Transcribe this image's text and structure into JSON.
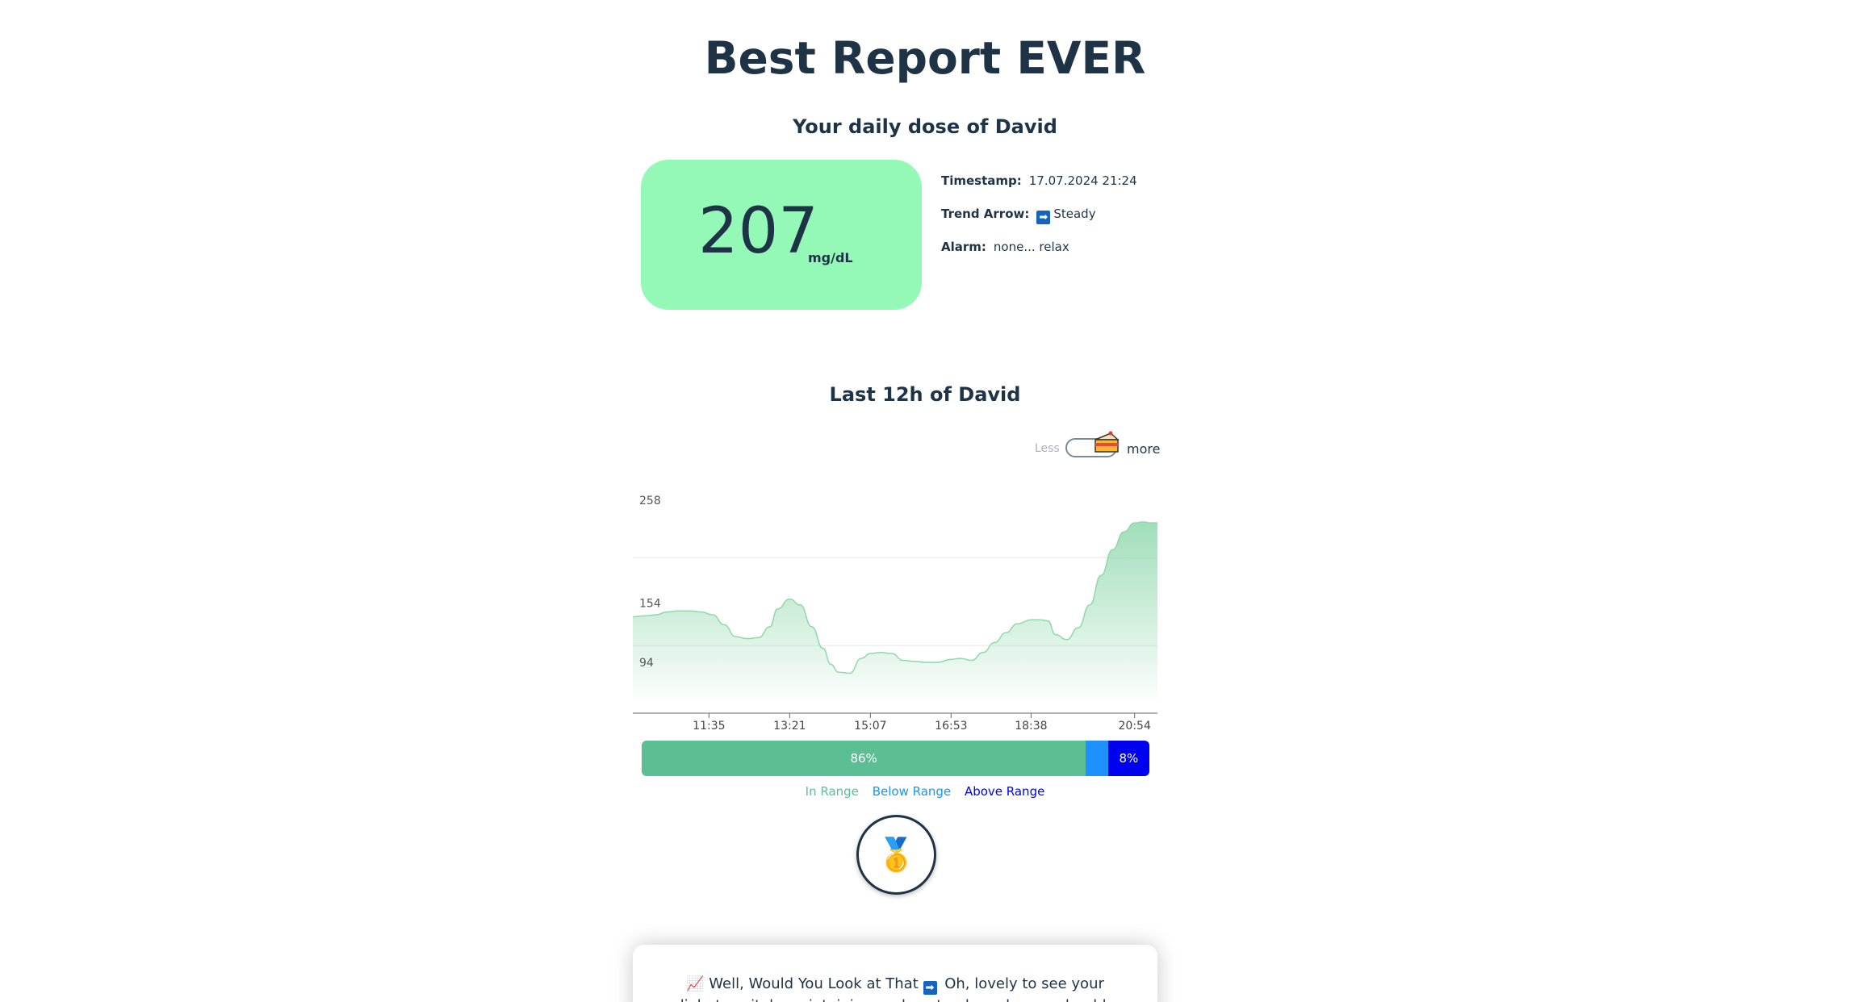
{
  "header": {
    "title": "Best Report EVER",
    "subtitle": "Your daily dose of David"
  },
  "reading": {
    "value": "207",
    "unit": "mg/dL",
    "card_color": "#94f9b7"
  },
  "info": {
    "timestamp_label": "Timestamp:",
    "timestamp_value": "17.07.2024 21:24",
    "trend_label": "Trend Arrow:",
    "trend_icon": "➡",
    "trend_value": "Steady",
    "alarm_label": "Alarm:",
    "alarm_value": "none... relax"
  },
  "chart_section": {
    "title": "Last 12h of David",
    "toggle_less": "Less",
    "toggle_more": "more",
    "toggle_icon": "cake-icon",
    "toggle_state": "on"
  },
  "chart_data": {
    "type": "area",
    "x_tick_labels": [
      "11:35",
      "13:21",
      "15:07",
      "16:53",
      "18:38",
      "20:54"
    ],
    "y_tick_labels": [
      "258",
      "154",
      "94"
    ],
    "ylim": [
      54,
      258
    ],
    "grid": "horizontal",
    "line_color": "#8fd8ac",
    "series": [
      {
        "x": [
          "09:55",
          "10:10",
          "10:25",
          "10:40",
          "10:55",
          "11:10",
          "11:25",
          "11:40",
          "11:55",
          "12:10",
          "12:25",
          "12:40",
          "12:55",
          "13:05",
          "13:21",
          "13:35",
          "13:50",
          "14:05",
          "14:15",
          "14:25",
          "14:40",
          "14:55",
          "15:07",
          "15:20",
          "15:35",
          "15:50",
          "16:05",
          "16:20",
          "16:35",
          "16:53",
          "17:05",
          "17:20",
          "17:35",
          "17:50",
          "18:05",
          "18:20",
          "18:38",
          "18:50",
          "19:00",
          "19:10",
          "19:25",
          "19:40",
          "19:55",
          "20:10",
          "20:25",
          "20:40",
          "20:54",
          "21:05",
          "21:15",
          "21:24"
        ],
        "values": [
          140,
          141,
          142,
          145,
          146,
          146,
          145,
          142,
          132,
          120,
          118,
          119,
          130,
          148,
          158,
          152,
          130,
          108,
          92,
          84,
          83,
          98,
          103,
          104,
          103,
          96,
          95,
          94,
          94,
          97,
          98,
          96,
          104,
          114,
          124,
          133,
          137,
          137,
          136,
          122,
          117,
          129,
          152,
          182,
          208,
          226,
          235,
          236,
          235,
          235
        ]
      }
    ]
  },
  "range_bar": {
    "in_range_pct": 86,
    "below_range_pct": 4.3,
    "above_range_pct": 8,
    "in_range_label": "86%",
    "above_range_label": "8%",
    "colors": {
      "in": "#5cbf94",
      "below": "#1e90ff",
      "above": "#0000f0"
    }
  },
  "legend": {
    "in_range": "In Range",
    "below_range": "Below Range",
    "above_range": "Above Range"
  },
  "medal": {
    "icon": "🥇",
    "icon_name": "medal-icon"
  },
  "message": {
    "icon1": "📈",
    "text1": "Well, Would You Look at That",
    "icon2": "➡",
    "text2": "Oh, lovely to see your diabetes vitals maintaining such a steady and ever-adorable high level."
  }
}
